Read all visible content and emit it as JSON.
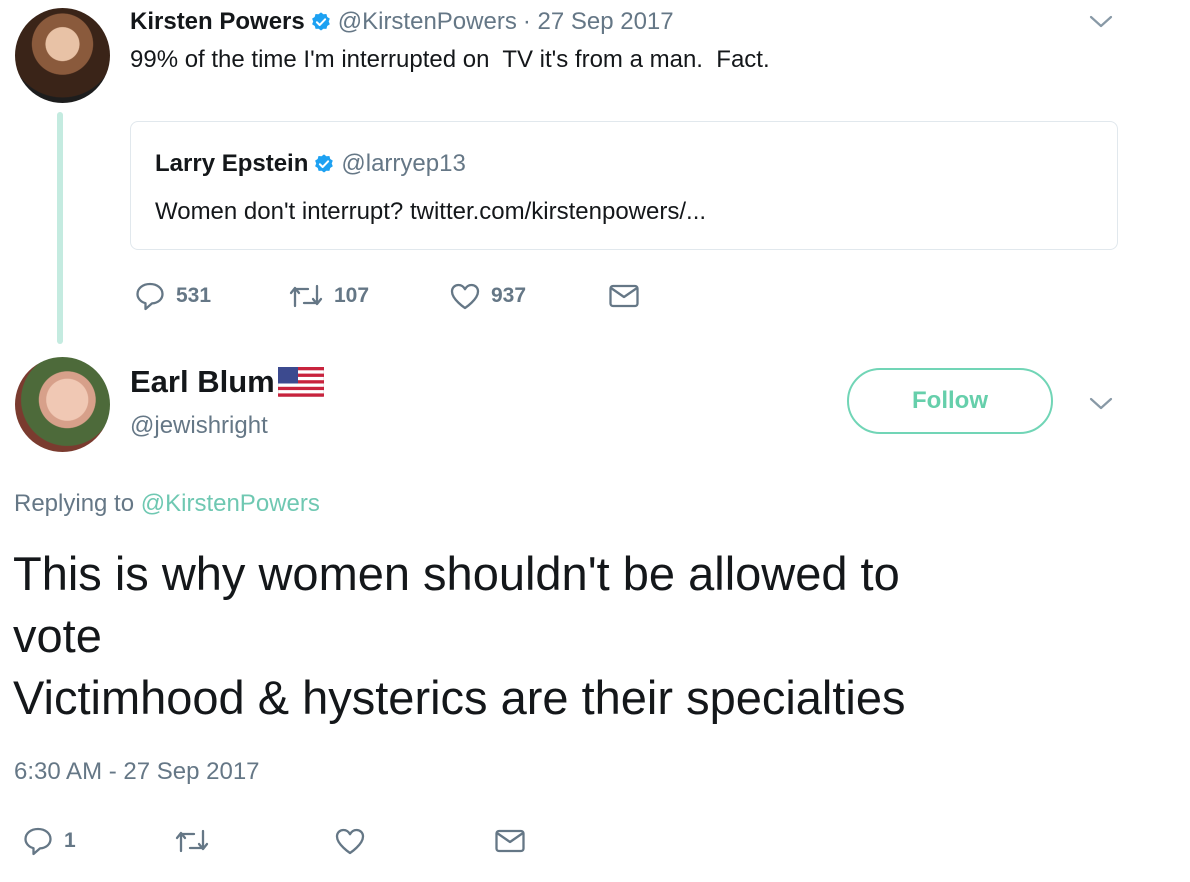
{
  "parent_tweet": {
    "name": "Kirsten Powers",
    "handle": "@KirstenPowers",
    "date": "· 27 Sep 2017",
    "text": "99% of the time I'm interrupted on  TV it's from a man.  Fact.",
    "quoted": {
      "name": "Larry Epstein",
      "handle": "@larryep13",
      "text": "Women don't interrupt? twitter.com/kirstenpowers/..."
    },
    "actions": {
      "replies": "531",
      "retweets": "107",
      "likes": "937"
    }
  },
  "reply_tweet": {
    "name": "Earl Blum",
    "handle": "@jewishright",
    "follow_label": "Follow",
    "replying_prefix": "Replying to",
    "replying_to": "@KirstenPowers",
    "text_lines": [
      "This is why women shouldn't be allowed to",
      "vote",
      "Victimhood & hysterics are their specialties"
    ],
    "timestamp": "6:30 AM - 27 Sep 2017",
    "actions": {
      "replies": "1"
    }
  },
  "colors": {
    "accent": "#66cfab",
    "muted": "#657786",
    "verified": "#1da1f2",
    "thread_line": "#c4ebe0"
  },
  "icons": [
    "verified-badge-icon",
    "chevron-down-icon",
    "reply-icon",
    "retweet-icon",
    "like-icon",
    "direct-message-icon",
    "us-flag-icon"
  ]
}
